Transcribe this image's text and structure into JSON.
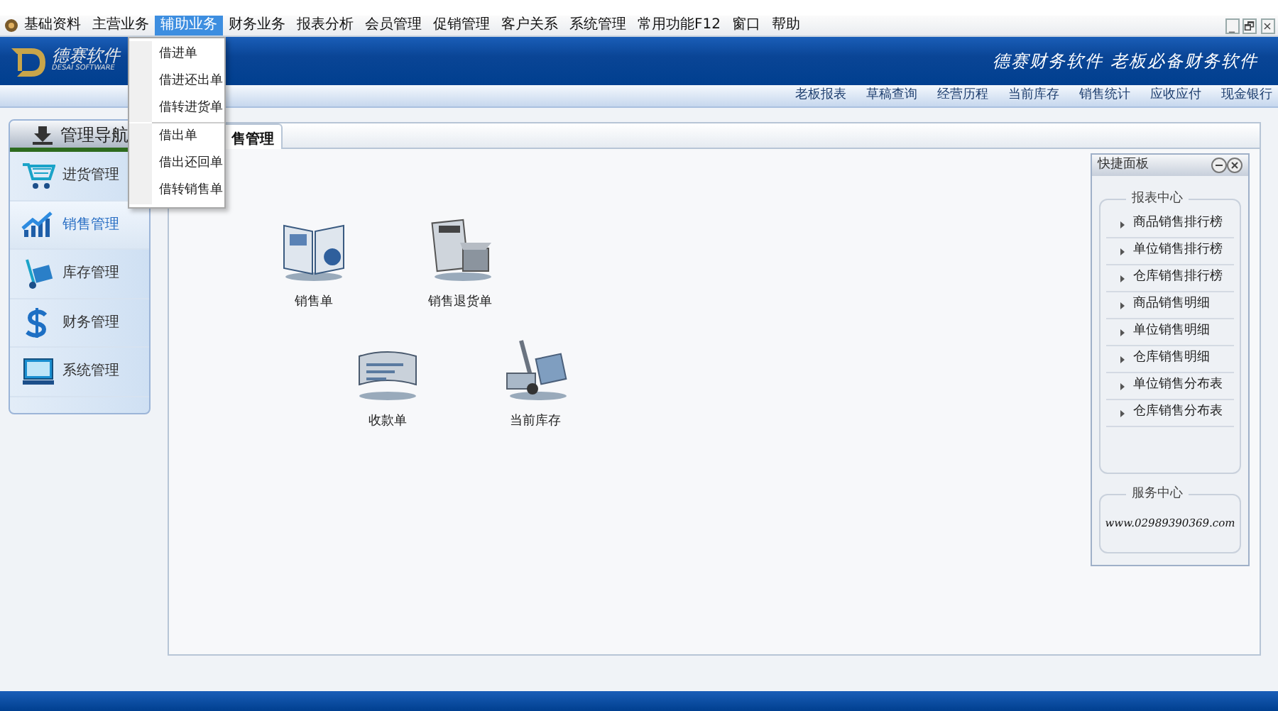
{
  "menu_bar": {
    "items": [
      {
        "label": "基础资料",
        "selected": false
      },
      {
        "label": "主营业务",
        "selected": false
      },
      {
        "label": "辅助业务",
        "selected": true
      },
      {
        "label": "财务业务",
        "selected": false
      },
      {
        "label": "报表分析",
        "selected": false
      },
      {
        "label": "会员管理",
        "selected": false
      },
      {
        "label": "促销管理",
        "selected": false
      },
      {
        "label": "客户关系",
        "selected": false
      },
      {
        "label": "系统管理",
        "selected": false
      },
      {
        "label": "常用功能F12",
        "selected": false
      },
      {
        "label": "窗口",
        "selected": false
      },
      {
        "label": "帮助",
        "selected": false
      }
    ],
    "window_buttons": [
      "_",
      "🗗",
      "×"
    ]
  },
  "dropdown": {
    "groups": [
      [
        "借进单",
        "借进还出单",
        "借转进货单"
      ],
      [
        "借出单",
        "借出还回单",
        "借转销售单"
      ]
    ]
  },
  "header": {
    "logo_title": "德赛软件",
    "logo_subtitle": "DESAI SOFTWARE",
    "slogan": "德赛财务软件 老板必备财务软件"
  },
  "toolbar": [
    "老板报表",
    "草稿查询",
    "经营历程",
    "当前库存",
    "销售统计",
    "应收应付",
    "现金银行"
  ],
  "navigation": {
    "title": "管理导航",
    "items": [
      {
        "label": "进货管理",
        "selected": false
      },
      {
        "label": "销售管理",
        "selected": true
      },
      {
        "label": "库存管理",
        "selected": false
      },
      {
        "label": "财务管理",
        "selected": false
      },
      {
        "label": "系统管理",
        "selected": false
      }
    ]
  },
  "tab": {
    "label": "售管理",
    "selected": true
  },
  "shortcuts": [
    {
      "label": "销售单"
    },
    {
      "label": "销售退货单"
    },
    {
      "label": "收款单"
    },
    {
      "label": "当前库存"
    }
  ],
  "quick_panel": {
    "title": "快捷面板",
    "report_group": {
      "title": "报表中心",
      "items": [
        "商品销售排行榜",
        "单位销售排行榜",
        "仓库销售排行榜",
        "商品销售明细",
        "单位销售明细",
        "仓库销售明细",
        "单位销售分布表",
        "仓库销售分布表"
      ]
    },
    "service_group": {
      "title": "服务中心",
      "text": "www.02989390369.com"
    }
  }
}
